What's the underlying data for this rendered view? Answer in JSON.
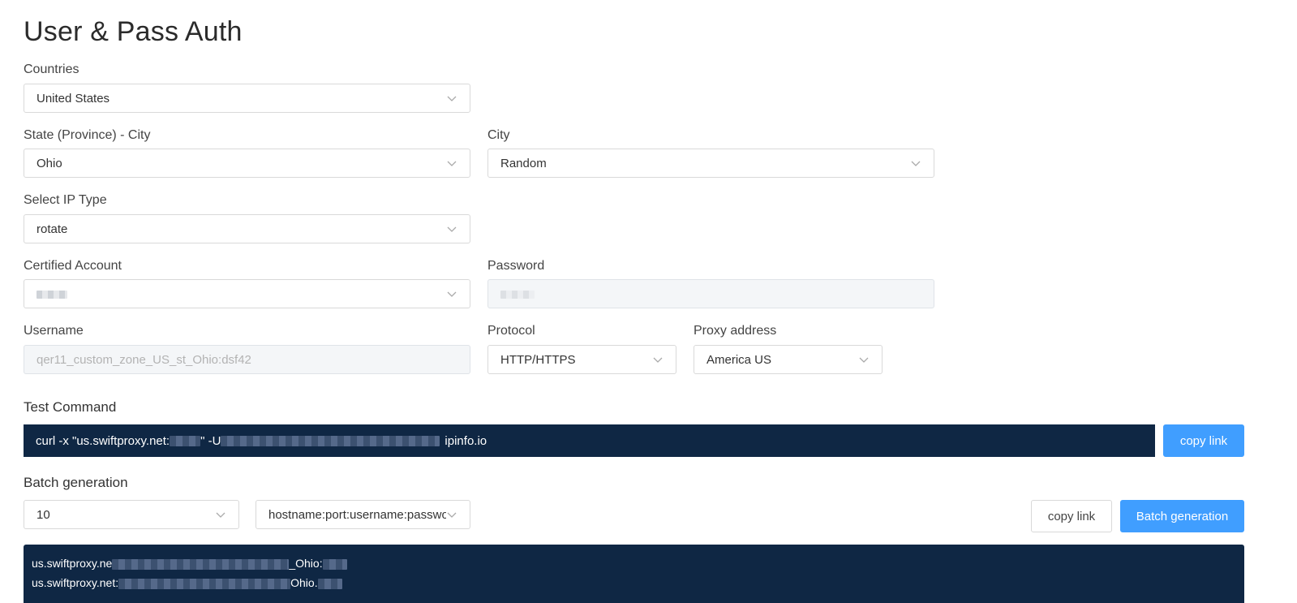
{
  "page": {
    "title": "User & Pass Auth"
  },
  "form": {
    "countries": {
      "label": "Countries",
      "value": "United States"
    },
    "state": {
      "label": "State (Province) - City",
      "value": "Ohio"
    },
    "city": {
      "label": "City",
      "value": "Random"
    },
    "ip_type": {
      "label": "Select IP Type",
      "value": "rotate"
    },
    "account": {
      "label": "Certified Account",
      "value": ""
    },
    "password": {
      "label": "Password",
      "value": ""
    },
    "username": {
      "label": "Username",
      "value": "qer11_custom_zone_US_st_Ohio:dsf42"
    },
    "protocol": {
      "label": "Protocol",
      "value": "HTTP/HTTPS"
    },
    "proxy_address": {
      "label": "Proxy address",
      "value": "America US"
    }
  },
  "test_command": {
    "label": "Test Command",
    "prefix": "curl -x \"us.swiftproxy.net:",
    "middle": "\" -U",
    "suffix": "ipinfo.io",
    "copy_label": "copy link"
  },
  "batch": {
    "label": "Batch generation",
    "count": "10",
    "format": "hostname:port:username:passwor",
    "copy_label": "copy link",
    "generate_label": "Batch generation",
    "lines": [
      {
        "prefix": "us.swiftproxy.ne",
        "middle": "_Ohio:"
      },
      {
        "prefix": "us.swiftproxy.net:",
        "middle": "Ohio."
      }
    ]
  },
  "icons": {
    "select": "chevron-down-icon"
  },
  "colors": {
    "accent": "#409eff",
    "console_bg": "#0f2744"
  }
}
